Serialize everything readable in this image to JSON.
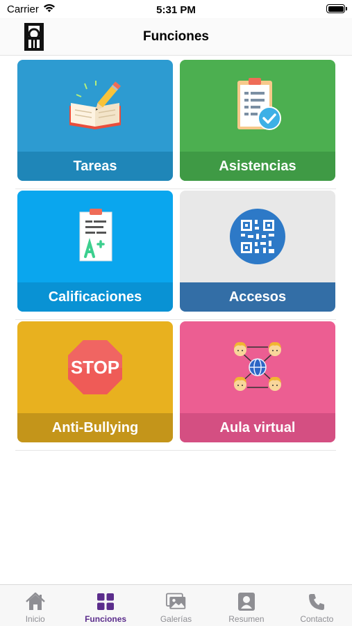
{
  "status_bar": {
    "carrier": "Carrier",
    "time": "5:31 PM"
  },
  "nav": {
    "title": "Funciones"
  },
  "tiles": [
    {
      "label": "Tareas",
      "icon": "notebook-pencil-icon",
      "color": "#2d9bd1",
      "label_bg": "#1f86b8"
    },
    {
      "label": "Asistencias",
      "icon": "clipboard-check-icon",
      "color": "#4caf50",
      "label_bg": "#3f9a45"
    },
    {
      "label": "Calificaciones",
      "icon": "grade-paper-icon",
      "color": "#0aa6ee",
      "label_bg": "#0992d4"
    },
    {
      "label": "Accesos",
      "icon": "qr-code-icon",
      "color": "#e8e8e8",
      "label_bg": "#336ea6"
    },
    {
      "label": "Anti-Bullying",
      "icon": "stop-sign-icon",
      "color": "#e8b11f",
      "label_bg": "#c4951a"
    },
    {
      "label": "Aula virtual",
      "icon": "network-people-icon",
      "color": "#ec5e92",
      "label_bg": "#d44f82"
    }
  ],
  "stop_text": "STOP",
  "tab_bar": {
    "items": [
      {
        "label": "Inicio",
        "icon": "home-icon"
      },
      {
        "label": "Funciones",
        "icon": "grid-icon"
      },
      {
        "label": "Galerías",
        "icon": "gallery-icon"
      },
      {
        "label": "Resumen",
        "icon": "profile-card-icon"
      },
      {
        "label": "Contacto",
        "icon": "phone-icon"
      }
    ],
    "active_color": "#5b2d8c",
    "inactive_color": "#8e8e93"
  }
}
